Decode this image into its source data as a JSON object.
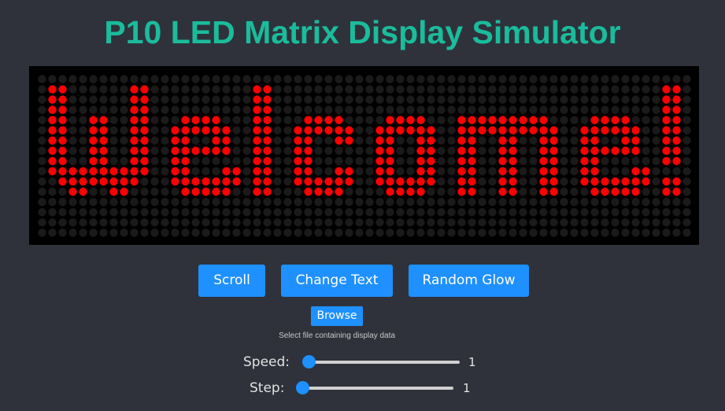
{
  "app": {
    "title": "P10 LED Matrix Display Simulator"
  },
  "display": {
    "text": "Welcome!",
    "cols": 64,
    "rows": 16,
    "on_color": "#ff0000",
    "off_color": "#1a1a1a",
    "background": "#000000"
  },
  "buttons": {
    "scroll": "Scroll",
    "change_text": "Change Text",
    "random_glow": "Random Glow",
    "browse": "Browse"
  },
  "file_hint": "Select file containing display data",
  "controls": {
    "speed": {
      "label": "Speed:",
      "value": "1",
      "fraction": 0.0
    },
    "step": {
      "label": "Step:",
      "value": "1",
      "fraction": 0.0
    }
  },
  "colors": {
    "title": "#1abc9c",
    "accent": "#1e90ff",
    "page_background": "#2f323b"
  }
}
